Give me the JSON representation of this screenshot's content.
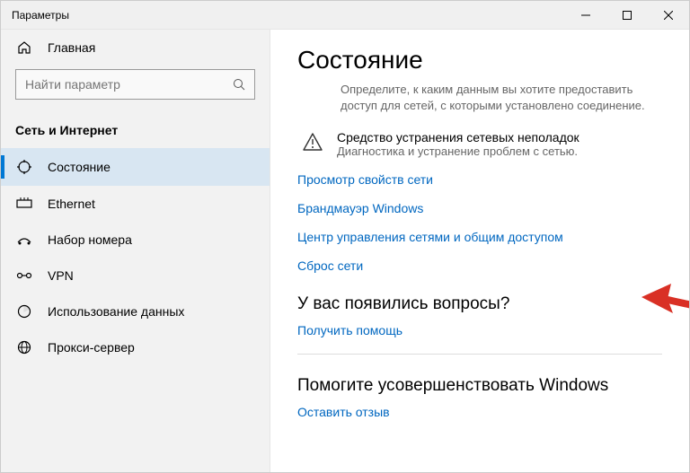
{
  "window": {
    "title": "Параметры"
  },
  "sidebar": {
    "home": "Главная",
    "search_placeholder": "Найти параметр",
    "category": "Сеть и Интернет",
    "items": [
      {
        "label": "Состояние"
      },
      {
        "label": "Ethernet"
      },
      {
        "label": "Набор номера"
      },
      {
        "label": "VPN"
      },
      {
        "label": "Использование данных"
      },
      {
        "label": "Прокси-сервер"
      }
    ]
  },
  "main": {
    "title": "Состояние",
    "desc": "Определите, к каким данным вы хотите предоставить доступ для сетей, с которыми установлено соединение.",
    "troubleshoot": {
      "title": "Средство устранения сетевых неполадок",
      "sub": "Диагностика и устранение проблем с сетью."
    },
    "links": {
      "props": "Просмотр свойств сети",
      "firewall": "Брандмауэр Windows",
      "sharing": "Центр управления сетями и общим доступом",
      "reset": "Сброс сети"
    },
    "questions": {
      "heading": "У вас появились вопросы?",
      "help": "Получить помощь"
    },
    "improve": {
      "heading": "Помогите усовершенствовать Windows",
      "feedback": "Оставить отзыв"
    }
  }
}
